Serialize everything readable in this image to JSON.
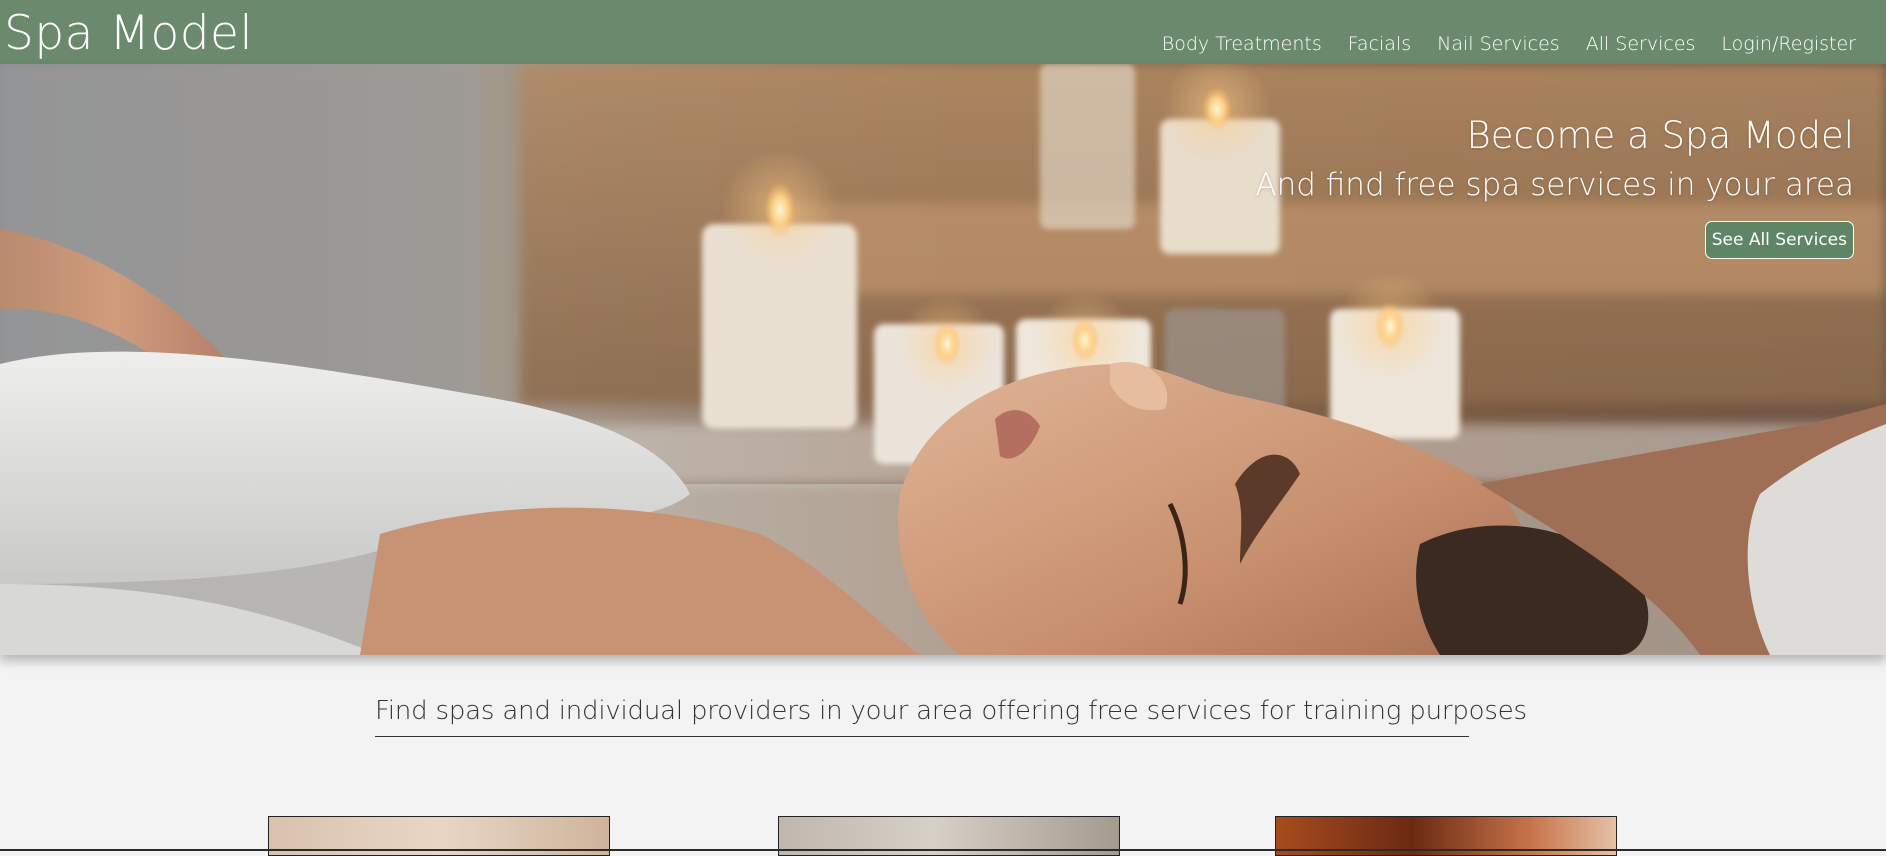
{
  "header": {
    "brand": "Spa Model",
    "nav": [
      {
        "label": "Body Treatments"
      },
      {
        "label": "Facials"
      },
      {
        "label": "Nail Services"
      },
      {
        "label": "All Services"
      },
      {
        "label": "Login/Register"
      }
    ]
  },
  "hero": {
    "title": "Become a Spa Model",
    "subtitle": "And find free spa services in your area",
    "cta_label": "See All Services"
  },
  "tagline": "Find spas and individual providers in your area offering free services for training purposes",
  "colors": {
    "header_bg": "#6b8a6d",
    "button_bg": "#5f8567",
    "page_bg": "#f3f3f3"
  }
}
